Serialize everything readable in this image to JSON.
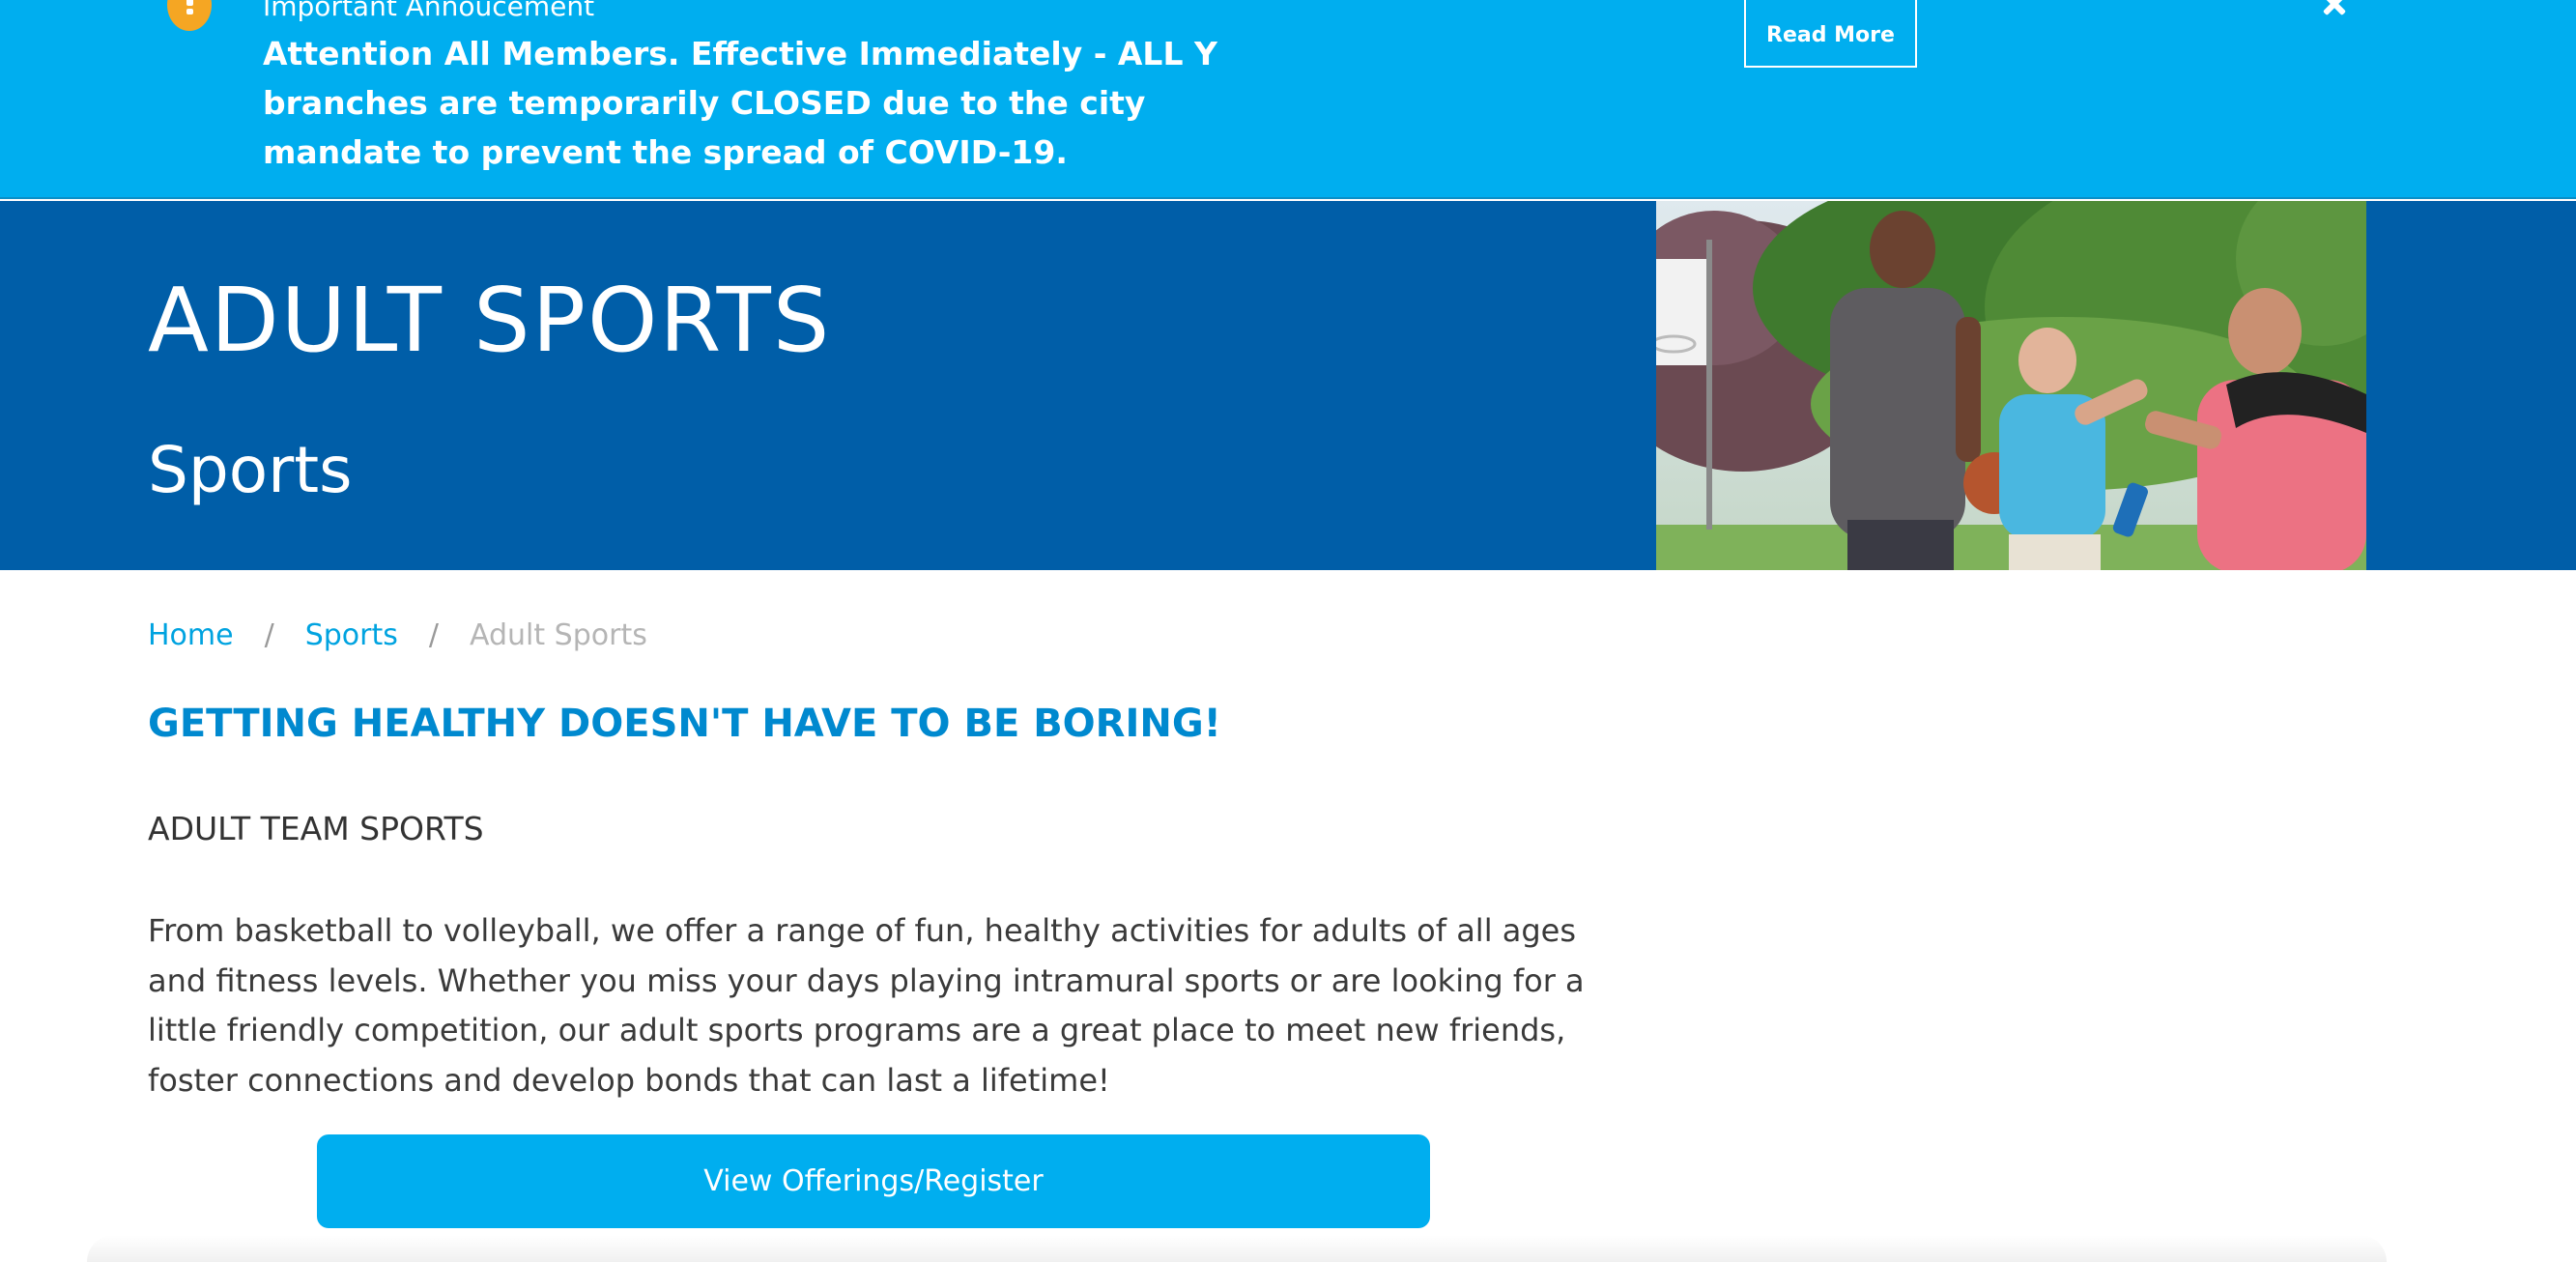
{
  "alert": {
    "heading": "Important Annoucement",
    "message": "Attention All Members. Effective Immediately - ALL Y branches are temporarily CLOSED due to the city mandate to prevent the spread of COVID-19.",
    "read_more_label": "Read More",
    "icon": "exclamation-icon",
    "close_icon": "close-icon",
    "background_color": "#00aeef",
    "icon_color": "#f5a623"
  },
  "hero": {
    "title": "ADULT SPORTS",
    "subtitle": "Sports",
    "background_color": "#005ea8"
  },
  "breadcrumb": {
    "items": [
      "Home",
      "Sports"
    ],
    "separator": "/",
    "current": "Adult Sports"
  },
  "main": {
    "headline": "GETTING HEALTHY DOESN'T HAVE TO BE BORING!",
    "section_heading": "ADULT TEAM SPORTS",
    "body": "From basketball to volleyball, we offer a range of fun, healthy activities for adults of all ages and fitness levels. Whether you miss your days playing intramural sports or are looking for a little friendly competition, our adult sports programs are a great place to meet new friends, foster connections and develop bonds that can last a lifetime!",
    "cta_label": "View Offerings/Register",
    "accent_color": "#0089cf",
    "button_color": "#00aeef"
  }
}
